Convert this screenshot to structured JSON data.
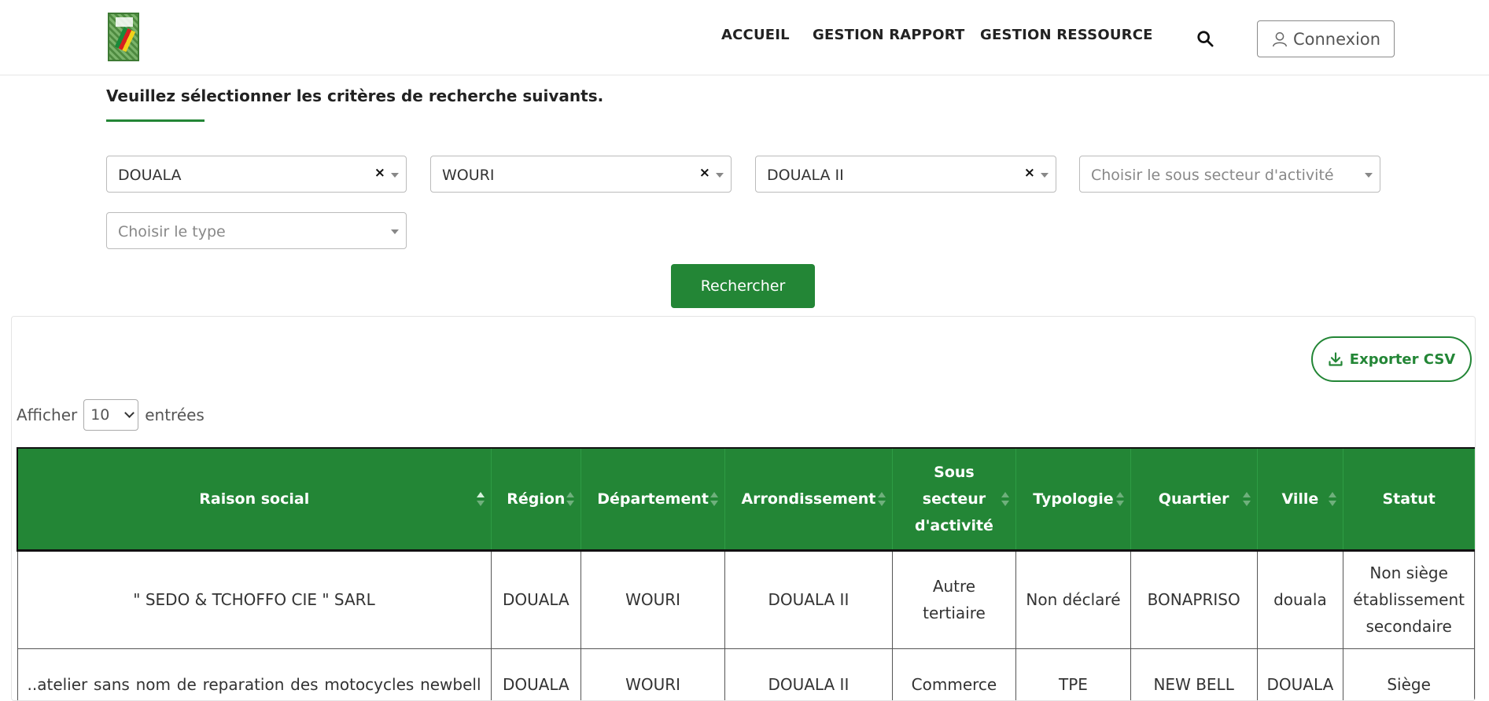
{
  "header": {
    "nav": [
      "ACCUEIL",
      "GESTION RAPPORT",
      "GESTION RESSOURCE"
    ],
    "login_label": "Connexion"
  },
  "criteria": {
    "title": "Veuillez sélectionner les critères de recherche suivants.",
    "region": "DOUALA",
    "departement": "WOURI",
    "arrondissement": "DOUALA II",
    "sous_secteur_placeholder": "Choisir le sous secteur d'activité",
    "type_placeholder": "Choisir le type",
    "clear_glyph": "×",
    "search_button": "Rechercher"
  },
  "table_panel": {
    "export_label": "Exporter CSV",
    "show_label": "Afficher",
    "entries_label": "entrées",
    "page_length": "10",
    "columns": [
      "Raison social",
      "Région",
      "Département",
      "Arrondissement",
      "Sous secteur d'activité",
      "Typologie",
      "Quartier",
      "Ville",
      "Statut"
    ],
    "rows": [
      [
        "\" SEDO & TCHOFFO CIE \" SARL",
        "DOUALA",
        "WOURI",
        "DOUALA II",
        "Autre tertiaire",
        "Non déclaré",
        "BONAPRISO",
        "douala",
        "Non siège établissement secondaire"
      ],
      [
        "..atelier sans nom de reparation des motocycles newbell",
        "DOUALA",
        "WOURI",
        "DOUALA II",
        "Commerce",
        "TPE",
        "NEW BELL",
        "DOUALA",
        "Siège"
      ]
    ]
  },
  "colors": {
    "brand_green": "#238636"
  }
}
